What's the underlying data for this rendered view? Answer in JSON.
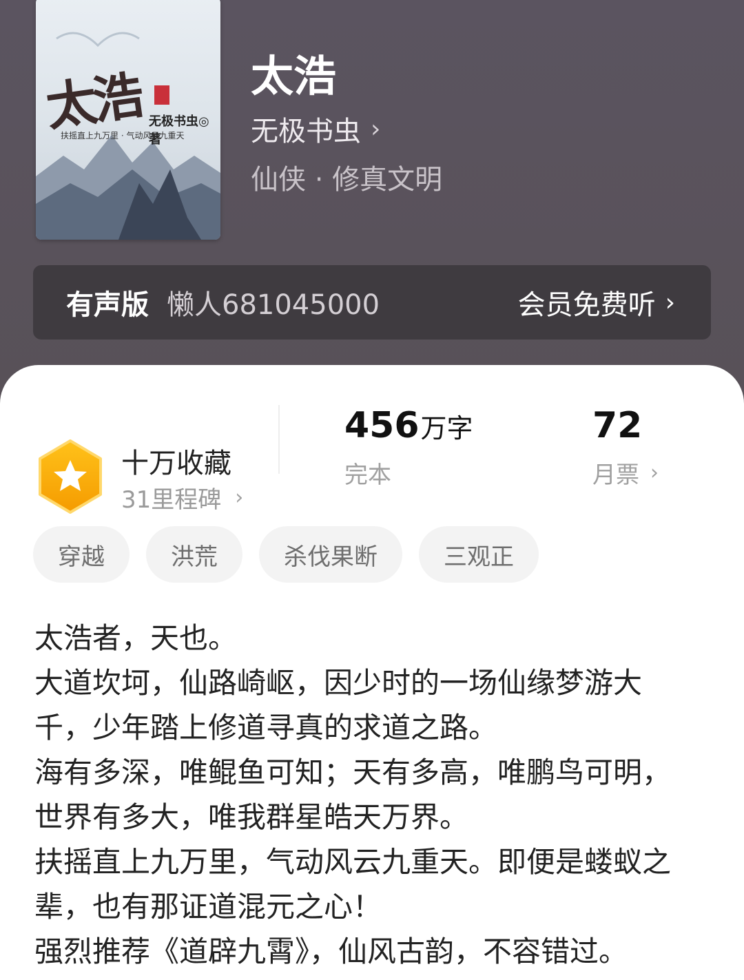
{
  "book": {
    "title": "太浩",
    "author": "无极书虫",
    "genre": "仙侠 · 修真文明",
    "cover": {
      "title": "太浩",
      "author": "无极书虫◎著",
      "slogan": "扶摇直上九万里 · 气动风云九重天"
    }
  },
  "audio": {
    "label": "有声版",
    "narrator": "懒人681045000",
    "action": "会员免费听"
  },
  "stats": {
    "collection_title": "十万收藏",
    "milestone": "31里程碑",
    "word_count": "456",
    "word_unit": "万字",
    "status": "完本",
    "monthly_votes": "72",
    "monthly_votes_label": "月票"
  },
  "tags": [
    "穿越",
    "洪荒",
    "杀伐果断",
    "三观正"
  ],
  "description": [
    "太浩者，天也。",
    "大道坎坷，仙路崎岖，因少时的一场仙缘梦游大千，少年踏上修道寻真的求道之路。",
    "海有多深，唯鲲鱼可知；天有多高，唯鹏鸟可明，世界有多大，唯我群星皓天万界。",
    "扶摇直上九万里，气动风云九重天。即便是蝼蚁之辈，也有那证道混元之心！",
    "强烈推荐《道辟九霄》，仙风古韵，不容错过。"
  ],
  "colors": {
    "header_bg": "#585158",
    "audio_bar_bg": "#3f3b40",
    "badge_orange": "#f7a800",
    "tag_bg": "#f3f3f3"
  },
  "icons": [
    "chevron-right-icon",
    "star-badge-icon"
  ]
}
